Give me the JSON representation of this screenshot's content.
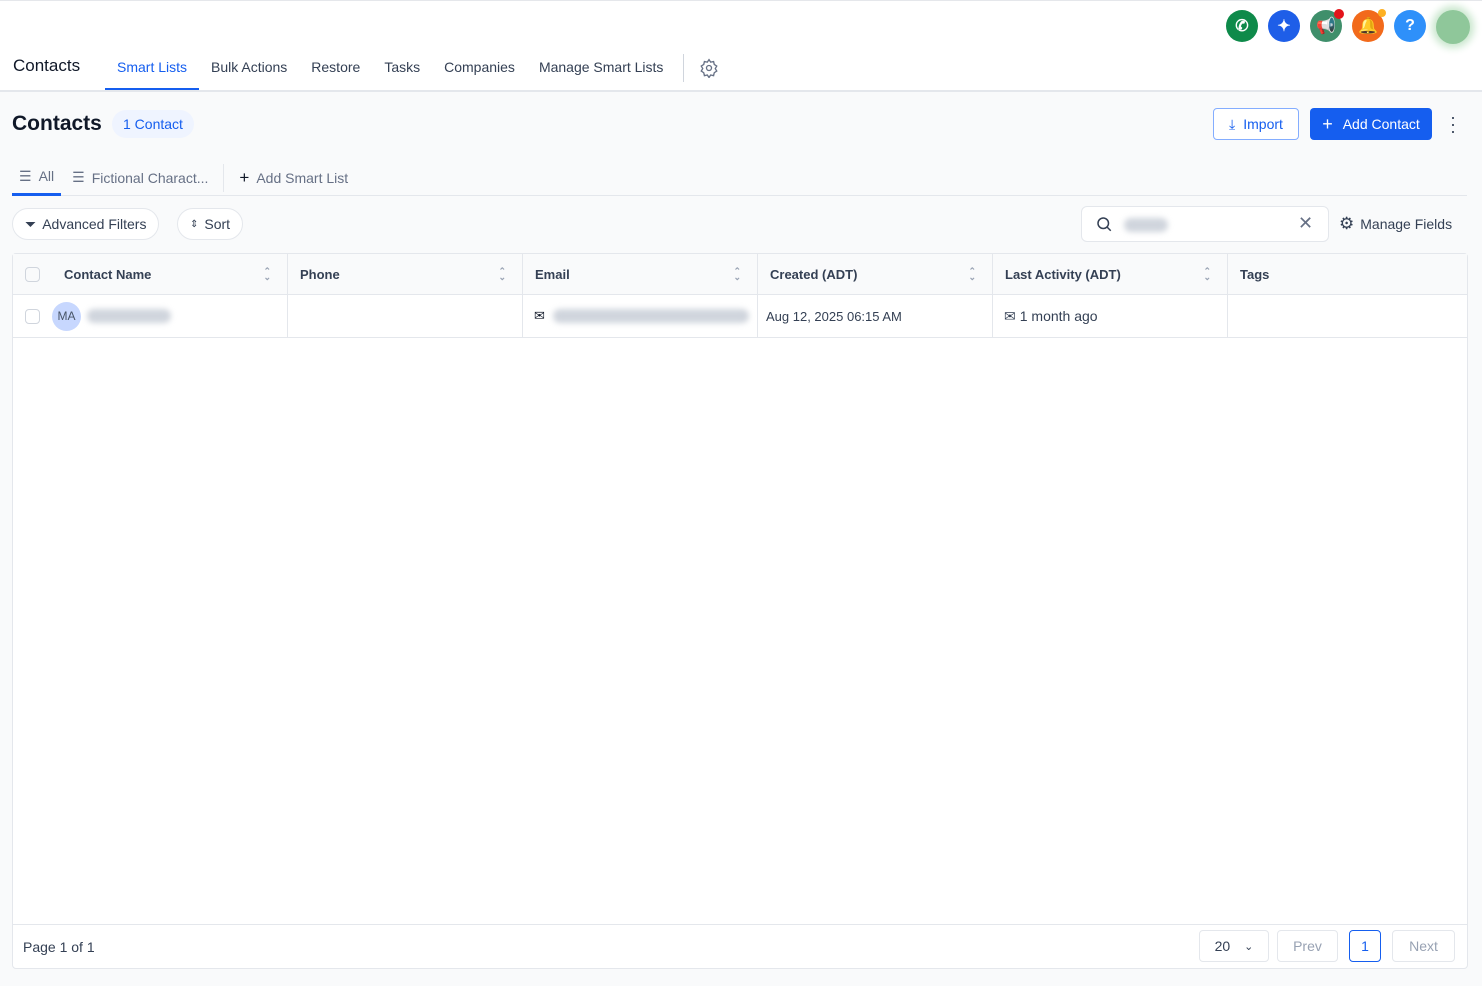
{
  "header": {
    "brand": "Contacts",
    "nav": [
      "Smart Lists",
      "Bulk Actions",
      "Restore",
      "Tasks",
      "Companies",
      "Manage Smart Lists"
    ],
    "help": "?"
  },
  "colors": {
    "accent": "#155eef",
    "phone": "#0e8a4a",
    "ai": "#1e5ee8",
    "announce": "#3f8f6b",
    "bell": "#f26a1b",
    "help": "#2e90fa"
  },
  "page": {
    "title": "Contacts",
    "count": "1 Contact",
    "import": "Import",
    "add_contact": "Add Contact"
  },
  "tabs": {
    "all": "All",
    "fictional": "Fictional Charact...",
    "add": "Add Smart List"
  },
  "filters": {
    "advanced": "Advanced Filters",
    "sort": "Sort",
    "manage_fields": "Manage Fields"
  },
  "table": {
    "columns": [
      "Contact Name",
      "Phone",
      "Email",
      "Created (ADT)",
      "Last Activity (ADT)",
      "Tags"
    ],
    "rows": [
      {
        "initials": "MA",
        "created": "Aug 12, 2025 06:15 AM",
        "last_activity": "1 month ago"
      }
    ]
  },
  "pagination": {
    "page_label": "Page 1 of 1",
    "per_page": "20",
    "prev": "Prev",
    "current": "1",
    "next": "Next"
  }
}
